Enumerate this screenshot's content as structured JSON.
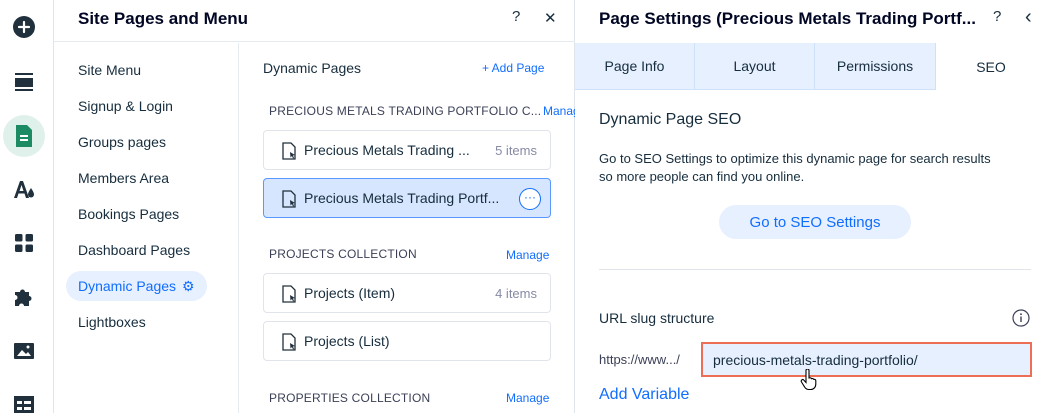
{
  "rail": {
    "items": [
      {
        "icon": "plus-circle-icon"
      },
      {
        "icon": "sections-icon"
      },
      {
        "icon": "pages-icon",
        "active": true
      },
      {
        "icon": "design-icon"
      },
      {
        "icon": "apps-icon"
      },
      {
        "icon": "puzzle-icon"
      },
      {
        "icon": "media-icon"
      },
      {
        "icon": "cms-icon"
      }
    ]
  },
  "panel1": {
    "title": "Site Pages and Menu",
    "help": "?",
    "close": "✕",
    "menu": [
      {
        "label": "Site Menu"
      },
      {
        "label": "Signup & Login"
      },
      {
        "label": "Groups pages"
      },
      {
        "label": "Members Area"
      },
      {
        "label": "Bookings Pages"
      },
      {
        "label": "Dashboard Pages"
      },
      {
        "label": "Dynamic Pages",
        "active": true
      },
      {
        "label": "Lightboxes"
      }
    ],
    "section_title": "Dynamic Pages",
    "add_page": "+ Add Page",
    "collections": [
      {
        "label": "PRECIOUS METALS TRADING PORTFOLIO C...",
        "manage": "Manag",
        "items": [
          {
            "name": "Precious Metals Trading ...",
            "count": "5 items"
          },
          {
            "name": "Precious Metals Trading Portf...",
            "more": "···",
            "selected": true
          }
        ]
      },
      {
        "label": "PROJECTS COLLECTION",
        "manage": "Manage",
        "items": [
          {
            "name": "Projects (Item)",
            "count": "4 items"
          },
          {
            "name": "Projects (List)"
          }
        ]
      },
      {
        "label": "PROPERTIES COLLECTION",
        "manage": "Manage",
        "items": []
      }
    ]
  },
  "panel2": {
    "title": "Page Settings (Precious Metals Trading Portf...",
    "help": "?",
    "back": "‹",
    "tabs": [
      {
        "label": "Page Info"
      },
      {
        "label": "Layout"
      },
      {
        "label": "Permissions"
      },
      {
        "label": "SEO",
        "active": true
      }
    ],
    "heading": "Dynamic Page SEO",
    "description": "Go to SEO Settings to optimize this dynamic page for search results so more people can find you online.",
    "seo_button": "Go to SEO Settings",
    "slug_label": "URL slug structure",
    "url_prefix": "https://www.../",
    "slug_value": "precious-metals-trading-portfolio/",
    "add_variable": "Add Variable"
  },
  "colors": {
    "accent": "#116dff",
    "selected_bg": "#d6e6fe",
    "highlight_border": "#ec6e55",
    "rail_active": "#e0f1ec"
  }
}
